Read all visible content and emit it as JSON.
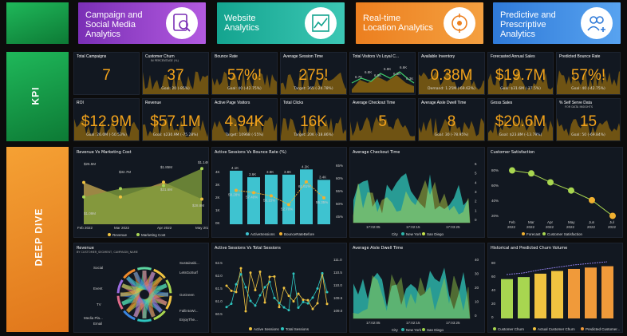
{
  "header": {
    "tiles": [
      {
        "label": "Campaign and Social Media Analytics",
        "lines": [
          "Campaign and",
          "Social Media",
          "Analytics"
        ],
        "icon": "search-person-icon",
        "color": "#8b3fc0"
      },
      {
        "label": "Website Analytics",
        "lines": [
          "Website",
          "Analytics"
        ],
        "icon": "chart-line-icon",
        "color": "#1bb7a1"
      },
      {
        "label": "Real-time Location Analytics",
        "lines": [
          "Real-time",
          "Location Analytics"
        ],
        "icon": "location-target-icon",
        "color": "#f08a2a"
      },
      {
        "label": "Predictive and Prescriptive Analytics",
        "lines": [
          "Predictive and",
          "Prescriptive",
          "Analytics"
        ],
        "icon": "people-add-icon",
        "color": "#3b86e0"
      }
    ]
  },
  "sections": {
    "kpi": "KPI",
    "deep_dive": "DEEP DIVE"
  },
  "kpis_row1": [
    {
      "label": "Total Campaigns",
      "value": "7",
      "goal": "",
      "sub": ""
    },
    {
      "label": "Customer Churn",
      "sub": "IN PERCENTAGE (%)",
      "value": "37",
      "goal": "Goal: 20 (-85%)"
    },
    {
      "label": "Bounce Rate",
      "value": "57%!",
      "goal": "Goal: 40 (-42.75%)",
      "sub": ""
    },
    {
      "label": "Average Session Time",
      "value": "275!",
      "goal": "Target: 365 (-24.78%)",
      "sub": ""
    },
    {
      "label": "Total Visitors Vs Loyal C...",
      "value": "",
      "goal": "",
      "sub": ""
    },
    {
      "label": "Available Inventory",
      "value": "0.38M",
      "goal": "Demand: 1.25M (-69.62%)",
      "sub": ""
    },
    {
      "label": "Forecasted Annual Sales",
      "value": "$19.7M",
      "goal": "Goal: $31.6M (-37.5%)",
      "sub": ""
    },
    {
      "label": "Predicted Bounce Rate",
      "value": "57%!",
      "goal": "Goal: 40 (-42.75%)",
      "sub": ""
    }
  ],
  "kpis_row2": [
    {
      "label": "ROI",
      "value": "$12.9M",
      "goal": "Goal: 26.0M (-50.53%)",
      "sub": ""
    },
    {
      "label": "Revenue",
      "value": "$57.1M",
      "goal": "Goal: $230.9M (-75.28%)",
      "sub": ""
    },
    {
      "label": "Active Page Visitors",
      "value": "4.94K",
      "goal": "Target: 10968 (-55%)",
      "sub": ""
    },
    {
      "label": "Total Clicks",
      "value": "16K",
      "goal": "Target: 20K (-18.86%)",
      "sub": ""
    },
    {
      "label": "Average Checkout Time",
      "value": "5",
      "goal": "",
      "sub": ""
    },
    {
      "label": "Average Aisle Dwell Time",
      "value": "8",
      "goal": "Goal: 30 (-78.95%)",
      "sub": ""
    },
    {
      "label": "Gross Sales",
      "value": "$20.6M",
      "goal": "Goal: $23.8M (-13.79%)",
      "sub": ""
    },
    {
      "label": "% Self Serve Data",
      "sub": "FOR DATA INSIGHTS",
      "value": "15",
      "goal": "Goal: 50 (-69.84%)"
    }
  ],
  "visitors_mini": {
    "labels": [
      "6.7K",
      "6.8K",
      "6.8K",
      "6.8K",
      "6.3K",
      "6.6K",
      "6.3K"
    ]
  },
  "charts": {
    "revenue_vs_marketing": {
      "title": "Revenue Vs Marketing Cost",
      "type": "area",
      "categories": [
        "Feb 2022",
        "Mar 2022",
        "Apr 2022",
        "May 2022"
      ],
      "series": [
        {
          "name": "Revenue",
          "values": [
            1.59,
            1.08,
            1.6,
            1.0
          ],
          "labels": [
            "$1.59M",
            "$1.08M",
            "$1.60M",
            "$1.00M"
          ]
        },
        {
          "name": "Marketing Cost",
          "values": [
            1.08,
            1.37,
            1.48,
            2.08
          ],
          "labels": [
            "$1.08M",
            "$1.37M",
            "$1.48M",
            "$2.08M"
          ]
        }
      ],
      "point_labels": [
        "$25.5M",
        "$1.09M",
        "$32.7M",
        "$1.85M",
        "$31.6M",
        "$1.14M",
        "$28.8M"
      ],
      "legend": [
        "Revenue",
        "Marketing Cost"
      ],
      "colors": [
        "#f0c340",
        "#a9d657"
      ]
    },
    "sessions_vs_bounce": {
      "title": "Active Sessions Vs Bounce Rate (%)",
      "type": "bar",
      "bar_labels": [
        "4.1K",
        "3.6K",
        "3.8K",
        "3.8K",
        "4.2K",
        "3.4K"
      ],
      "bar_values": [
        4.1,
        3.6,
        3.8,
        3.8,
        4.2,
        3.4
      ],
      "line_labels": [
        "58.28%",
        "57.40%",
        "56.15%",
        "52.70%",
        "61.61%",
        "55.35%"
      ],
      "line_values": [
        58.28,
        57.4,
        56.15,
        52.7,
        61.61,
        55.35
      ],
      "y_ticks": [
        "4K",
        "3K",
        "2K",
        "1K",
        "0K"
      ],
      "y2_ticks": [
        "65%",
        "60%",
        "55%",
        "50%",
        "45%"
      ],
      "legend": [
        "ActiveSessions",
        "BounceRateBefore"
      ],
      "colors": [
        "#3ec3d0",
        "#f0b030"
      ]
    },
    "checkout_time": {
      "title": "Average Checkout Time",
      "type": "area",
      "y_ticks": [
        "6",
        "5",
        "4",
        "3",
        "2",
        "1",
        "0"
      ],
      "x_ticks": [
        "17:02:05",
        "17:02:15",
        "17:03:25"
      ],
      "legend_title": "City",
      "legend": [
        "New York",
        "San Diego"
      ],
      "colors": [
        "#2db3a8",
        "#c4e14a"
      ]
    },
    "customer_satisfaction": {
      "title": "Customer Satisfaction",
      "type": "line",
      "categories": [
        "Feb 2022",
        "Mar 2022",
        "Apr 2022",
        "May 2022",
        "Jun 2022",
        "Jul 2022"
      ],
      "values": [
        78,
        74,
        62,
        51,
        38,
        17
      ],
      "y_ticks": [
        "80%",
        "60%",
        "40%",
        "20%"
      ],
      "legend": [
        "Forecast",
        "Customer Satisfaction"
      ],
      "colors": [
        "#f0b030",
        "#a8d650"
      ]
    },
    "revenue_chord": {
      "title": "Revenue",
      "subtitle": "BY CUSTOMER_SEGMENT, CAMPAIGN_NAME",
      "left_labels": [
        "Social",
        "Event",
        "TV",
        "Media Pla...",
        "Email"
      ],
      "right_labels": [
        "Sustainabi...",
        "LetsGoSurf",
        "GoGreen",
        "FallintoWi...",
        "EnjoyThe..."
      ]
    },
    "sessions_vs_total": {
      "title": "Active Sessions Vs Total Sessions",
      "type": "line",
      "y_ticks": [
        "62.5",
        "62.0",
        "61.5",
        "61.0",
        "60.5"
      ],
      "y2_ticks": [
        "111.0",
        "110.5",
        "110.0",
        "109.5",
        "109.0"
      ],
      "legend": [
        "Active Sessions",
        "Total Sessions"
      ],
      "colors": [
        "#f0c340",
        "#2ec6c0"
      ]
    },
    "aisle_dwell": {
      "title": "Average Aisle Dwell Time",
      "type": "area",
      "y_ticks": [
        "40",
        "30",
        "20",
        "10",
        "0"
      ],
      "x_ticks": [
        "17:02:05",
        "17:02:15",
        "17:03:25"
      ],
      "legend_title": "City",
      "legend": [
        "New York",
        "San Diego"
      ],
      "colors": [
        "#2db3a8",
        "#9bd24a"
      ]
    },
    "churn_volume": {
      "title": "Historical and Predicted Churn Volume",
      "type": "bar",
      "values": [
        58,
        61,
        66,
        70,
        73,
        75,
        77
      ],
      "y_ticks": [
        "80",
        "60",
        "40",
        "20",
        "0"
      ],
      "legend": [
        "Customer Churn",
        "Actual Customer Churn",
        "Predicted Customer..."
      ],
      "colors": [
        "#a8d650",
        "#f0c340",
        "#f09a3a"
      ]
    }
  }
}
